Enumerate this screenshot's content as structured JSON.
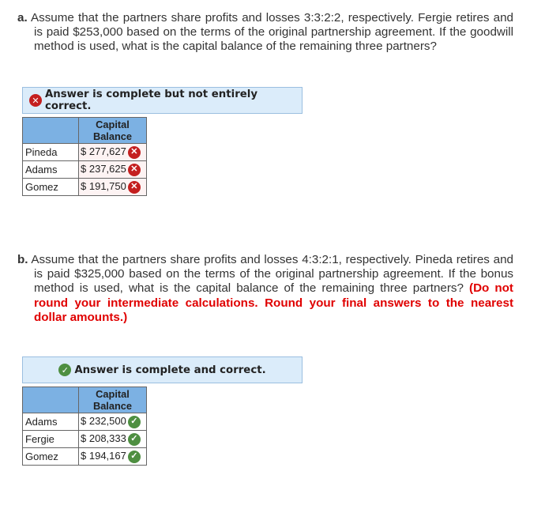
{
  "part_a": {
    "label": "a.",
    "question": "Assume that the partners share profits and losses 3:3:2:2, respectively. Fergie retires and is paid $253,000 based on the terms of the original partnership agreement. If the goodwill method is used, what is the capital balance of the remaining three partners?",
    "banner": {
      "status": "incorrect",
      "icon": "x-circle-icon",
      "text": "Answer is complete but not entirely correct."
    },
    "table": {
      "header": [
        "",
        "Capital Balance"
      ],
      "rows": [
        {
          "name": "Pineda",
          "currency": "$",
          "value": "277,627",
          "status": "incorrect"
        },
        {
          "name": "Adams",
          "currency": "$",
          "value": "237,625",
          "status": "incorrect"
        },
        {
          "name": "Gomez",
          "currency": "$",
          "value": "191,750",
          "status": "incorrect"
        }
      ]
    }
  },
  "part_b": {
    "label": "b.",
    "question": "Assume that the partners share profits and losses 4:3:2:1, respectively. Pineda retires and is paid $325,000 based on the terms of the original partnership agreement. If the bonus method is used, what is the capital balance of the remaining three partners?",
    "instruction": "(Do not round your intermediate calculations. Round your final answers to the nearest dollar amounts.)",
    "banner": {
      "status": "correct",
      "icon": "check-circle-icon",
      "text": "Answer is complete and correct."
    },
    "table": {
      "header": [
        "",
        "Capital Balance"
      ],
      "rows": [
        {
          "name": "Adams",
          "currency": "$",
          "value": "232,500",
          "status": "correct"
        },
        {
          "name": "Fergie",
          "currency": "$",
          "value": "208,333",
          "status": "correct"
        },
        {
          "name": "Gomez",
          "currency": "$",
          "value": "194,167",
          "status": "correct"
        }
      ]
    }
  },
  "colors": {
    "incorrect": "#c41f1f",
    "correct": "#4e8f41",
    "banner_bg": "#dbecfa",
    "header_bg": "#7cb1e3",
    "instruction": "#e00000"
  }
}
